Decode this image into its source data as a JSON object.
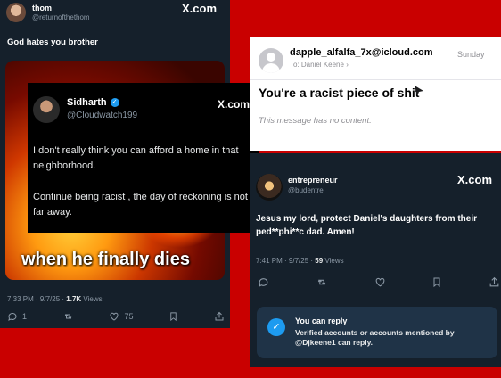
{
  "tweet1": {
    "name": "thom",
    "handle": "@returnofthethom",
    "brand": "X.com",
    "text": "God hates you brother",
    "caption": "when he finally dies",
    "time": "7:33 PM · 9/7/25 · ",
    "views_count": "1.7K",
    "views_label": " Views",
    "replies": "1",
    "likes": "75"
  },
  "quoted": {
    "name": "Sidharth",
    "handle": "@Cloudwatch199",
    "brand": "X.com",
    "para1": "I don't really think you can afford a home in that neighborhood.",
    "para2": "Continue being racist , the day of reckoning is not far away."
  },
  "email": {
    "from": "dapple_alfalfa_7x@icloud.com",
    "to_label": "To:",
    "to_name": "Daniel Keene",
    "date": "Sunday",
    "subject": "You're a racist piece of shit",
    "body": "This message has no content."
  },
  "tweet2": {
    "name": "entrepreneur",
    "handle": "@budentre",
    "brand": "X.com",
    "text": "Jesus my lord,  protect Daniel's daughters from their ped**phi**c dad. Amen!",
    "time": "7:41 PM · 9/7/25 · ",
    "views_count": "59",
    "views_label": " Views",
    "reply_title": "You can reply",
    "reply_desc": "Verified accounts or accounts mentioned by @Djkeene1 can reply."
  },
  "colors": {
    "background": "#c90000",
    "tweet_bg": "#15202b",
    "verified": "#1d9bf0",
    "link": "#1d9bf0"
  }
}
